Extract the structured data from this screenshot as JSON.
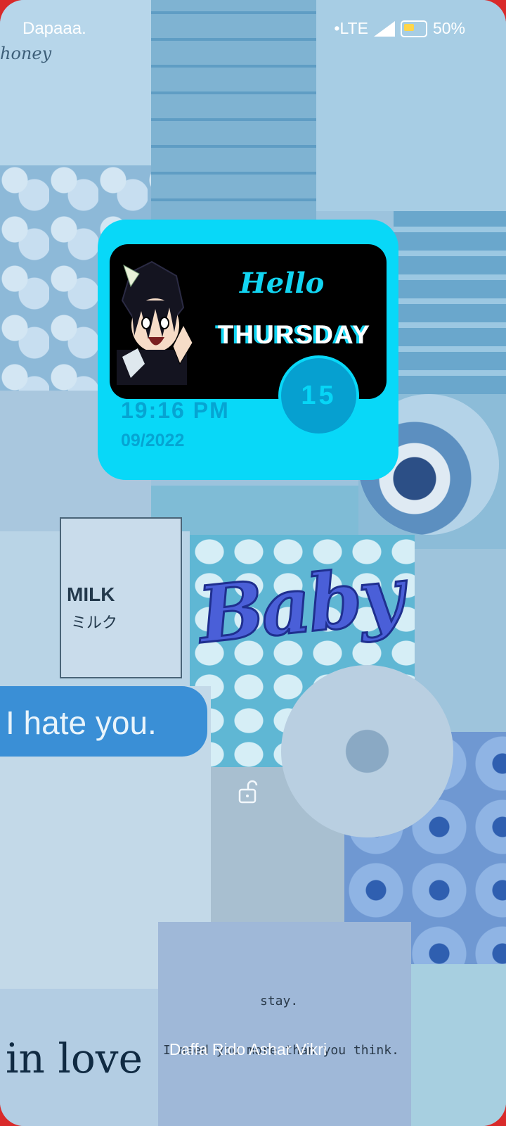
{
  "status_bar": {
    "carrier": "Dapaaa.",
    "network": "•LTE",
    "battery": "50%"
  },
  "widget": {
    "greeting": "Hello",
    "day_name": "THURSDAY",
    "day_number": "15",
    "time": "19:16 PM",
    "month_year": "09/2022"
  },
  "wallpaper": {
    "honey_text": "honey",
    "milk_label": "MILK",
    "milk_jp": "ミルク",
    "hate_text": "I hate you.",
    "baby_text": "Baby",
    "in_love_text": "in love",
    "stay_text": "stay.",
    "need_text": "I need you more than you think."
  },
  "lockscreen": {
    "owner_text": "Daffa Rido Ashar Vikri"
  },
  "colors": {
    "widget_bg": "#08d8f8",
    "accent": "#12d5f2",
    "frame": "#d92a2a"
  }
}
